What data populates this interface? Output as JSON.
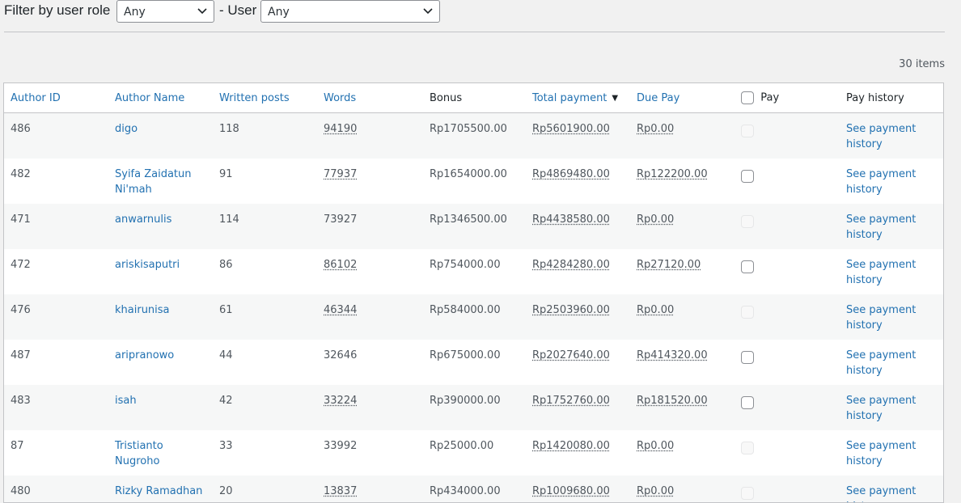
{
  "filters": {
    "role_label": "Filter by user role",
    "role_value": "Any",
    "user_label": "- User",
    "user_value": "Any"
  },
  "items_count": "30 items",
  "table": {
    "columns": {
      "author_id": "Author ID",
      "author_name": "Author Name",
      "written_posts": "Written posts",
      "words": "Words",
      "bonus": "Bonus",
      "total_payment": "Total payment",
      "due_pay": "Due Pay",
      "pay": "Pay",
      "pay_history": "Pay history"
    },
    "rows": [
      {
        "id": "486",
        "name": "digo",
        "posts": "118",
        "words": "94190",
        "words_dotted": true,
        "bonus": "Rp1705500.00",
        "total": "Rp5601900.00",
        "due": "Rp0.00",
        "pay_enabled": false,
        "history": "See payment history"
      },
      {
        "id": "482",
        "name": "Syifa Zaidatun Ni'mah",
        "posts": "91",
        "words": "77937",
        "words_dotted": true,
        "bonus": "Rp1654000.00",
        "total": "Rp4869480.00",
        "due": "Rp122200.00",
        "pay_enabled": true,
        "history": "See payment history"
      },
      {
        "id": "471",
        "name": "anwarnulis",
        "posts": "114",
        "words": "73927",
        "words_dotted": false,
        "bonus": "Rp1346500.00",
        "total": "Rp4438580.00",
        "due": "Rp0.00",
        "pay_enabled": false,
        "history": "See payment history"
      },
      {
        "id": "472",
        "name": "ariskisaputri",
        "posts": "86",
        "words": "86102",
        "words_dotted": true,
        "bonus": "Rp754000.00",
        "total": "Rp4284280.00",
        "due": "Rp27120.00",
        "pay_enabled": true,
        "history": "See payment history"
      },
      {
        "id": "476",
        "name": "khairunisa",
        "posts": "61",
        "words": "46344",
        "words_dotted": true,
        "bonus": "Rp584000.00",
        "total": "Rp2503960.00",
        "due": "Rp0.00",
        "pay_enabled": false,
        "history": "See payment history"
      },
      {
        "id": "487",
        "name": "aripranowo",
        "posts": "44",
        "words": "32646",
        "words_dotted": false,
        "bonus": "Rp675000.00",
        "total": "Rp2027640.00",
        "due": "Rp414320.00",
        "pay_enabled": true,
        "history": "See payment history"
      },
      {
        "id": "483",
        "name": "isah",
        "posts": "42",
        "words": "33224",
        "words_dotted": true,
        "bonus": "Rp390000.00",
        "total": "Rp1752760.00",
        "due": "Rp181520.00",
        "pay_enabled": true,
        "history": "See payment history"
      },
      {
        "id": "87",
        "name": "Tristianto Nugroho",
        "posts": "33",
        "words": "33992",
        "words_dotted": false,
        "bonus": "Rp25000.00",
        "total": "Rp1420080.00",
        "due": "Rp0.00",
        "pay_enabled": false,
        "history": "See payment history"
      },
      {
        "id": "480",
        "name": "Rizky Ramadhan",
        "posts": "20",
        "words": "13837",
        "words_dotted": true,
        "bonus": "Rp434000.00",
        "total": "Rp1009680.00",
        "due": "Rp0.00",
        "pay_enabled": false,
        "history": "See payment history"
      }
    ]
  },
  "icons": {
    "select": "chevron-down-icon",
    "sort": "sort-desc-icon"
  }
}
